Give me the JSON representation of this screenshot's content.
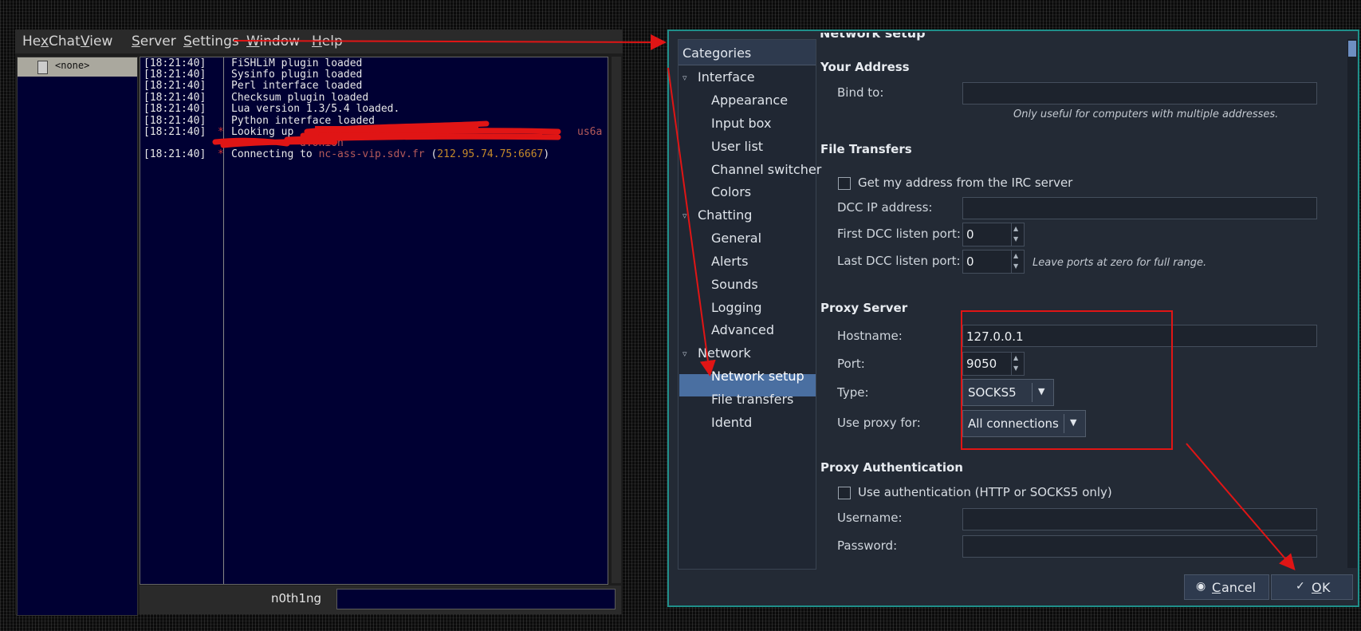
{
  "hexchat": {
    "menu": [
      {
        "pre": "He",
        "u": "x",
        "post": "Chat"
      },
      {
        "pre": "",
        "u": "V",
        "post": "iew"
      },
      {
        "pre": "",
        "u": "S",
        "post": "erver"
      },
      {
        "pre": "",
        "u": "S",
        "post": "ettings"
      },
      {
        "pre": "",
        "u": "W",
        "post": "indow"
      },
      {
        "pre": "",
        "u": "H",
        "post": "elp"
      }
    ],
    "tree_item": "<none>",
    "log": [
      {
        "ts": "[18:21:40]",
        "star": "",
        "msg": "FiSHLiM plugin loaded"
      },
      {
        "ts": "[18:21:40]",
        "star": "",
        "msg": "Sysinfo plugin loaded"
      },
      {
        "ts": "[18:21:40]",
        "star": "",
        "msg": "Perl interface loaded"
      },
      {
        "ts": "[18:21:40]",
        "star": "",
        "msg": "Checksum plugin loaded"
      },
      {
        "ts": "[18:21:40]",
        "star": "",
        "msg": "Lua version 1.3/5.4 loaded."
      },
      {
        "ts": "[18:21:40]",
        "star": "",
        "msg": "Python interface loaded"
      },
      {
        "ts": "[18:21:40]",
        "star": "*",
        "msg": "Looking up"
      }
    ],
    "lookup_tail": "us6a",
    "onion_tail": "d.onion",
    "connect": {
      "ts": "[18:21:40]",
      "star": "*",
      "prefix": "Connecting to ",
      "host": "nc-ass-vip.sdv.fr",
      "open": " (",
      "ip": "212.95.74.75:6667",
      "close": ")"
    },
    "nick": "n0th1ng"
  },
  "prefs": {
    "categories_header": "Categories",
    "clipped_title": "Network setup",
    "categories": {
      "interface": "Interface",
      "appearance": "Appearance",
      "input_box": "Input box",
      "user_list": "User list",
      "channel_switcher": "Channel switcher",
      "colors": "Colors",
      "chatting": "Chatting",
      "general": "General",
      "alerts": "Alerts",
      "sounds": "Sounds",
      "logging": "Logging",
      "advanced": "Advanced",
      "network": "Network",
      "network_setup": "Network setup",
      "file_transfers": "File transfers",
      "identd": "Identd"
    },
    "your_address": {
      "title": "Your Address",
      "bind_label": "Bind to:",
      "bind_value": "",
      "note": "Only useful for computers with multiple addresses."
    },
    "file_transfers": {
      "title": "File Transfers",
      "get_addr_label": "Get my address from the IRC server",
      "dcc_ip_label": "DCC IP address:",
      "first_port_label": "First DCC listen port:",
      "first_port": "0",
      "last_port_label": "Last DCC listen port:",
      "last_port": "0",
      "ports_note": "Leave ports at zero for full range."
    },
    "proxy": {
      "title": "Proxy Server",
      "hostname_label": "Hostname:",
      "hostname": "127.0.0.1",
      "port_label": "Port:",
      "port": "9050",
      "type_label": "Type:",
      "type": "SOCKS5",
      "use_for_label": "Use proxy for:",
      "use_for": "All connections"
    },
    "proxy_auth": {
      "title": "Proxy Authentication",
      "use_auth_label": "Use authentication (HTTP or SOCKS5 only)",
      "username_label": "Username:",
      "password_label": "Password:"
    },
    "buttons": {
      "cancel_u": "C",
      "cancel_rest": "ancel",
      "ok_u": "O",
      "ok_rest": "K"
    }
  },
  "colors": {
    "annotation_red": "#e01515",
    "selection_blue": "#4a6fa1",
    "dialog_border": "#1f8f8a"
  }
}
